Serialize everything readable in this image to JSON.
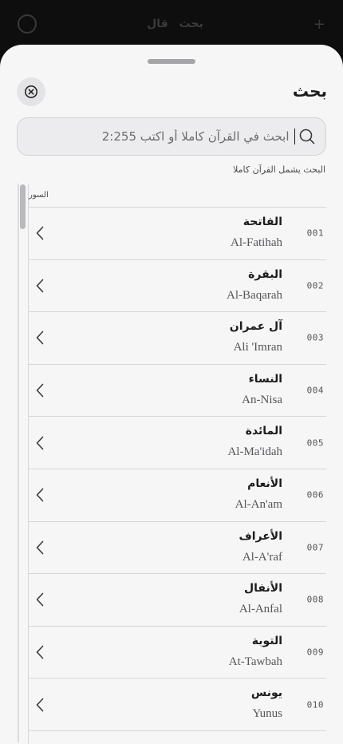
{
  "background_bar": {
    "items": [
      "قال",
      "بحث"
    ]
  },
  "sheet": {
    "title": "بحث",
    "search": {
      "value": "",
      "placeholder": "ابحث في القرآن كاملا أو اكتب 2:255"
    },
    "hint": "البحث يشمل القرآن كاملا",
    "section_header": "السور",
    "surahs": [
      {
        "number": "001",
        "arabic": "الفاتحة",
        "latin": "Al-Fatihah"
      },
      {
        "number": "002",
        "arabic": "البقرة",
        "latin": "Al-Baqarah"
      },
      {
        "number": "003",
        "arabic": "آل عمران",
        "latin": "Ali 'Imran"
      },
      {
        "number": "004",
        "arabic": "النساء",
        "latin": "An-Nisa"
      },
      {
        "number": "005",
        "arabic": "المائدة",
        "latin": "Al-Ma'idah"
      },
      {
        "number": "006",
        "arabic": "الأنعام",
        "latin": "Al-An'am"
      },
      {
        "number": "007",
        "arabic": "الأعراف",
        "latin": "Al-A'raf"
      },
      {
        "number": "008",
        "arabic": "الأنفال",
        "latin": "Al-Anfal"
      },
      {
        "number": "009",
        "arabic": "التوبة",
        "latin": "At-Tawbah"
      },
      {
        "number": "010",
        "arabic": "يونس",
        "latin": "Yunus"
      }
    ]
  },
  "icons": {
    "close": "close-circle-icon",
    "search": "search-icon",
    "row_chevron": "chevron-left-icon"
  },
  "colors": {
    "sheet_bg": "#f6f6f6",
    "search_bg": "#ececee",
    "text_primary": "#1c1c1e",
    "text_secondary": "#55555a",
    "divider": "#d6d6d9"
  }
}
